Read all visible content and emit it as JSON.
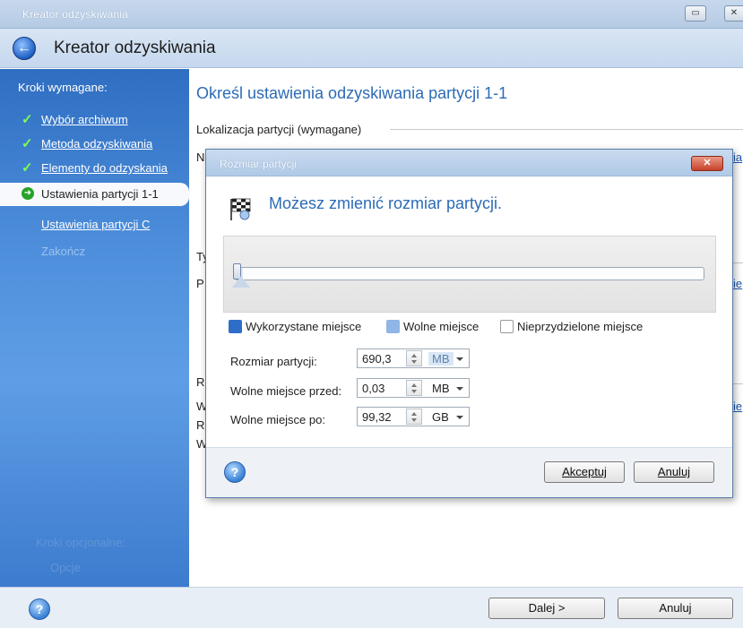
{
  "window": {
    "title": "Kreator odzyskiwania",
    "app_title": "Kreator odzyskiwania",
    "controls": {
      "minimize": "▭",
      "close": "✕"
    }
  },
  "sidebar": {
    "section_title": "Kroki wymagane:",
    "items": [
      {
        "label": "Wybór archiwum",
        "state": "done"
      },
      {
        "label": "Metoda odzyskiwania",
        "state": "done"
      },
      {
        "label": "Elementy do odzyskania",
        "state": "done"
      },
      {
        "label": "Ustawienia partycji 1-1",
        "state": "active"
      },
      {
        "label": "Ustawienia partycji C",
        "state": "pending"
      },
      {
        "label": "Zakończ",
        "state": "disabled"
      }
    ],
    "optional_title": "Kroki opcjonalne:",
    "optional_item": "Opcje"
  },
  "main": {
    "heading": "Określ ustawienia odzyskiwania partycji 1-1",
    "group_label": "Lokalizacja partycji (wymagane)",
    "letters": [
      "N",
      "Ty",
      "P",
      "R",
      "W",
      "R",
      "W"
    ],
    "links": [
      "ia",
      "ie",
      "ie"
    ]
  },
  "dialog": {
    "title": "Rozmiar partycji",
    "heading": "Możesz zmienić rozmiar partycji.",
    "slider_used_fraction": 0.015,
    "legend": [
      {
        "label": "Wykorzystane miejsce",
        "color": "#2f6ec8"
      },
      {
        "label": "Wolne miejsce",
        "color": "#8fb6e6"
      },
      {
        "label": "Nieprzydzielone miejsce",
        "color": "#ffffff"
      }
    ],
    "fields": [
      {
        "label": "Rozmiar partycji:",
        "value": "690,3",
        "unit": "MB",
        "highlighted": true
      },
      {
        "label": "Wolne miejsce przed:",
        "value": "0,03",
        "unit": "MB",
        "highlighted": false
      },
      {
        "label": "Wolne miejsce po:",
        "value": "99,32",
        "unit": "GB",
        "highlighted": false
      }
    ],
    "accept_button": "Akceptuj",
    "cancel_button": "Anuluj",
    "help_icon": "?"
  },
  "footer": {
    "next_button": "Dalej >",
    "cancel_button": "Anuluj",
    "help_icon": "?"
  }
}
